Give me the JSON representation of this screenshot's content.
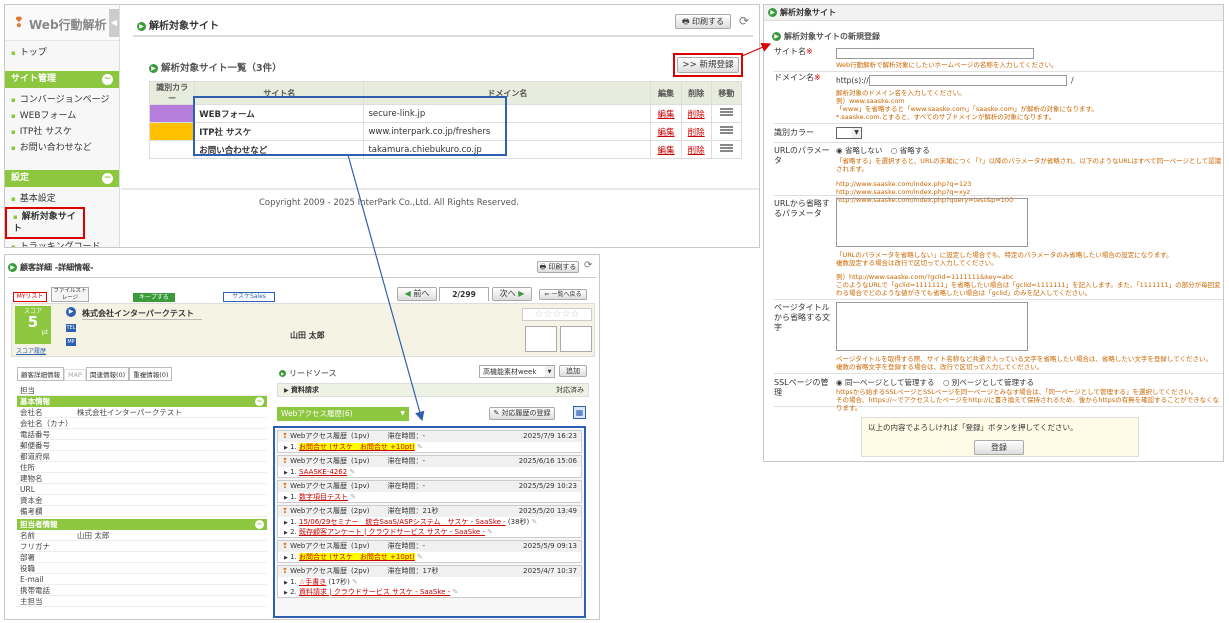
{
  "panel1": {
    "logo": "Web行動解析",
    "nav_top": "トップ",
    "site_mgmt_header": "サイト管理",
    "site_mgmt_items": [
      "コンバージョンページ",
      "WEBフォーム",
      "ITP社 サスケ",
      "お問い合わせなど"
    ],
    "settings_header": "設定",
    "settings_items": [
      "基本設定",
      "解析対象サイト",
      "トラッキングコード"
    ],
    "page_title": "解析対象サイト",
    "print_label": "印刷する",
    "list_title": "解析対象サイト一覧（3件）",
    "new_button": ">> 新規登録",
    "table": {
      "headers": [
        "識別カラー",
        "サイト名",
        "ドメイン名",
        "編集",
        "削除",
        "移動"
      ],
      "rows": [
        {
          "color": "#b57edc",
          "name": "WEBフォーム",
          "domain": "secure-link.jp",
          "edit": "編集",
          "del": "削除"
        },
        {
          "color": "#ffc000",
          "name": "ITP社 サスケ",
          "domain": "www.interpark.co.jp/freshers",
          "edit": "編集",
          "del": "削除"
        },
        {
          "color": "#ffffff",
          "name": "お問い合わせなど",
          "domain": "takamura.chiebukuro.co.jp",
          "edit": "編集",
          "del": "削除"
        }
      ]
    },
    "copyright": "Copyright 2009 - 2025 InterPark Co.,Ltd. All Rights Reserved."
  },
  "panel2": {
    "title": "解析対象サイト",
    "sub_title": "解析対象サイトの新規登録",
    "site_name_label": "サイト名",
    "required": "※",
    "site_name_note": "Web行動解析で解析対象にしたいホームページの名称を入力してください。",
    "domain_label": "ドメイン名",
    "domain_prefix": "http(s)://",
    "domain_suffix": "/",
    "domain_notes": [
      "解析対象のドメイン名を入力してください。",
      "例）www.saaske.com",
      "「www」を省略すると「www.saaske.com」「saaske.com」が解析の対象になります。",
      "*.saaske.com.とすると、すべてのサブドメインが解析の対象になります。"
    ],
    "color_label": "識別カラー",
    "url_param_label": "URLのパラメータ",
    "radio_omit_no": "省略しない",
    "radio_omit_yes": "省略する",
    "url_param_note": "「省略する」を選択すると、URLの末尾につく「?」以降のパラメータが省略され、以下のようなURLはすべて同一ページとして認識されます。",
    "url_examples": [
      "http://www.saaske.com/index.php?q=123",
      "http://www.saaske.com/index.php?q=xyz",
      "http://www.saaske.com/index.php?query=test&p=100"
    ],
    "url_omit_label": "URLから省略するパラメータ",
    "url_omit_notes": [
      "「URLのパラメータを省略しない」に設定した場合でも、特定のパラメータのみ省略したい場合の設定になります。",
      "複数設定する場合は改行で区切って入力してください。",
      "",
      "例）http://www.saaske.com/?gclid=1111111&key=abc",
      "このようなURLで「gclid=1111111」を省略したい場合は「gclid=1111111」を記入します。また、「1111111」の部分が毎回変わる場合でどのような値がきても省略したい場合は「gclid」のみを記入してください。"
    ],
    "page_title_label": "ページタイトルから省略する文字",
    "page_title_notes": [
      "ページタイトルを取得する際、サイト名称など共通で入っている文字を省略したい場合は、省略したい文字を登録してください。",
      "複数の省略文字を登録する場合は、改行で区切って入力してください。"
    ],
    "ssl_label": "SSLページの管理",
    "ssl_same": "同一ページとして管理する",
    "ssl_diff": "別ページとして管理する",
    "ssl_notes": [
      "httpsから始まるSSLページとSSLページを同一ページとみなす場合は、「同一ページとして管理する」を選択してください。",
      "その場合、https://~でアクセスしたページをhttp://に書き換えて保持されるため、後からhttpsの有無を確認することができなくなります。"
    ],
    "submit_note": "以上の内容でよろしければ「登録」ボタンを押してください。",
    "submit_label": "登録"
  },
  "panel3": {
    "title": "顧客詳細 -詳細情報-",
    "print_label": "印刷する",
    "tabs": [
      "MYリスト",
      "ファイルストレージ",
      "キープする",
      "サスケSales"
    ],
    "prev_label": "前へ",
    "page_count": "2/299",
    "next_label": "次へ",
    "back_label": "一覧へ戻る",
    "score_label": "スコア",
    "score_value": "5",
    "score_unit": "pt",
    "score_history": "スコア履歴",
    "company": "株式会社インターパークテスト",
    "person": "山田 太郎",
    "detail_tabs": [
      "顧客詳細情報",
      "MAP",
      "関連情報(0)",
      "重複情報(0)"
    ],
    "basic_fields_head": "担当",
    "basic_header": "基本情報",
    "basic_fields": [
      {
        "label": "会社名",
        "value": "株式会社インターパークテスト"
      },
      {
        "label": "会社名（カナ）",
        "value": ""
      },
      {
        "label": "電話番号",
        "value": ""
      },
      {
        "label": "郵便番号",
        "value": ""
      },
      {
        "label": "都道府県",
        "value": ""
      },
      {
        "label": "住所",
        "value": ""
      },
      {
        "label": "建物名",
        "value": ""
      },
      {
        "label": "URL",
        "value": ""
      },
      {
        "label": "資本金",
        "value": ""
      },
      {
        "label": "備考欄",
        "value": ""
      }
    ],
    "contact_header": "担当者情報",
    "contact_fields": [
      {
        "label": "名前",
        "value": "山田 太郎"
      },
      {
        "label": "フリガナ",
        "value": ""
      },
      {
        "label": "部署",
        "value": ""
      },
      {
        "label": "役職",
        "value": ""
      },
      {
        "label": "E-mail",
        "value": ""
      },
      {
        "label": "携帯電話",
        "value": ""
      },
      {
        "label": "主担当",
        "value": ""
      }
    ],
    "lead_source_label": "リードソース",
    "lead_select": "高機能素材week",
    "add_label": "追加",
    "doc_request": "資料請求",
    "doc_status": "対応済み",
    "web_history_select": "Webアクセス履歴(6)",
    "register_history": "対応履歴の登録",
    "access_label": "Webアクセス履歴",
    "stay_label": "滞在時間：",
    "access_rows": [
      {
        "pv": "(1pv)",
        "stay": "-",
        "date": "2025/7/9 16:23",
        "lines": [
          {
            "n": "1.",
            "t": "お問合せ (サスケ　お問合せ +10pt)",
            "hl": true
          }
        ]
      },
      {
        "pv": "(1pv)",
        "stay": "-",
        "date": "2025/6/16 15:06",
        "lines": [
          {
            "n": "1.",
            "t": "SAASKE-4262",
            "hl": false
          }
        ]
      },
      {
        "pv": "(1pv)",
        "stay": "-",
        "date": "2025/5/29 10:23",
        "lines": [
          {
            "n": "1.",
            "t": "数字項目テスト",
            "hl": false
          }
        ]
      },
      {
        "pv": "(2pv)",
        "stay": "21秒",
        "date": "2025/5/20 13:49",
        "lines": [
          {
            "n": "1.",
            "t": "15/06/29セミナー　統合SaaS/ASPシステム　サスケ - SaaSke -",
            "extra": "(38秒)",
            "hl": false
          },
          {
            "n": "2.",
            "t": "既存顧客アンケート | クラウドサービス サスケ - SaaSke -",
            "hl": false
          }
        ]
      },
      {
        "pv": "(1pv)",
        "stay": "-",
        "date": "2025/5/9 09:13",
        "lines": [
          {
            "n": "1.",
            "t": "お問合せ (サスケ　お問合せ +10pt)",
            "hl": true
          }
        ]
      },
      {
        "pv": "(2pv)",
        "stay": "17秒",
        "date": "2025/4/7 10:37",
        "lines": [
          {
            "n": "1.",
            "t": "☆手書き",
            "extra": "(17秒)",
            "hl": false
          },
          {
            "n": "2.",
            "t": "資料請求 | クラウドサービス サスケ - SaaSke -",
            "hl": false
          }
        ]
      }
    ]
  }
}
